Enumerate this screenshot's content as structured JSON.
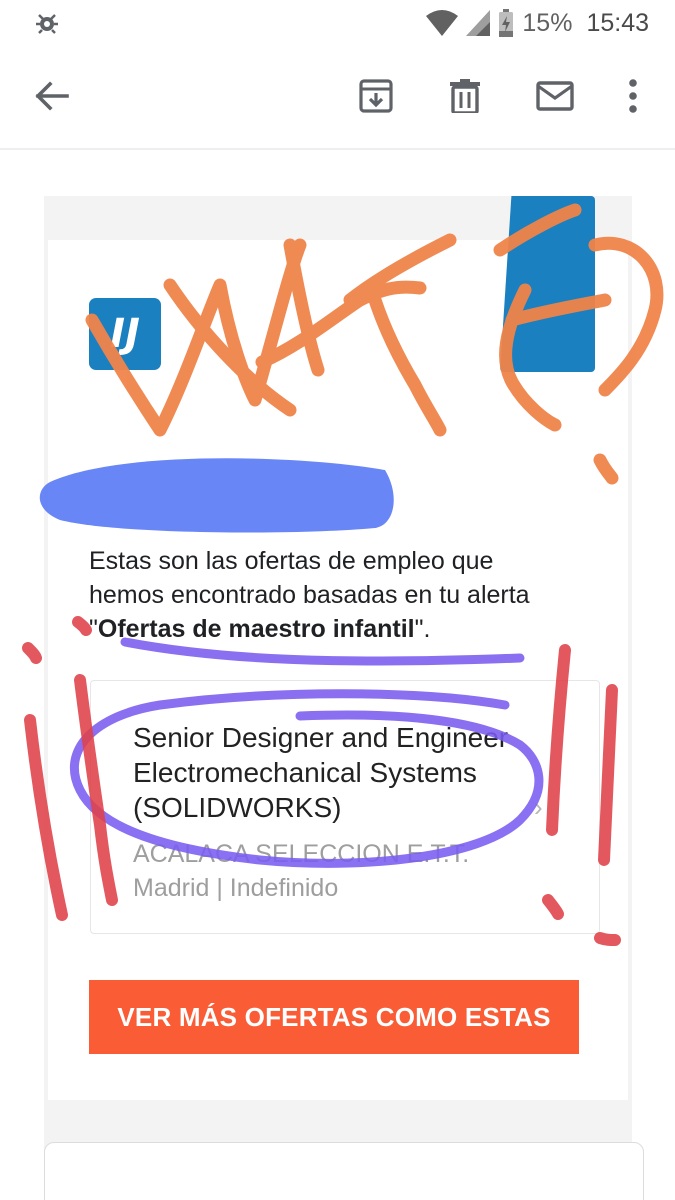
{
  "status_bar": {
    "battery_percent": "15%",
    "time": "15:43",
    "icons": [
      "debug-bug-icon",
      "wifi-icon",
      "cell-signal-icon",
      "battery-icon"
    ]
  },
  "toolbar": {
    "icons": [
      "back-arrow-icon",
      "archive-icon",
      "trash-icon",
      "mail-icon",
      "more-vert-icon"
    ]
  },
  "email": {
    "logo_left_text": "IJ",
    "intro_text": "Estas son las ofertas de empleo que hemos encontrado basadas en tu alerta \"",
    "alert_name": "Ofertas de maestro infantil",
    "intro_end": "\".",
    "job": {
      "title": "Senior Designer and Engineer Electromechanical Systems (SOLIDWORKS)",
      "company": "ACALACA SELECCION E.T.T.",
      "location": "Madrid | Indefinido",
      "chevron": "›"
    },
    "cta_label": "VER MÁS OFERTAS COMO ESTAS"
  },
  "colors": {
    "brand_blue": "#1a80c0",
    "cta_orange": "#fa5d36",
    "scribble_orange": "#f0844a",
    "scribble_blue": "#5b7cf5",
    "scribble_purple": "#7a5cf0",
    "scribble_red": "#e0424a"
  }
}
